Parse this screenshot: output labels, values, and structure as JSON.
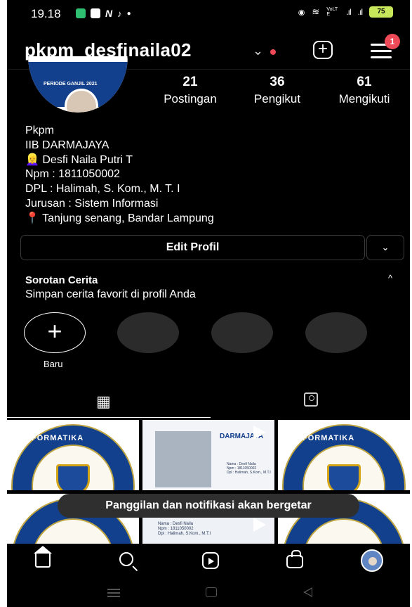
{
  "status_bar": {
    "time": "19.18",
    "signal_text": "VoLTE",
    "battery": "75"
  },
  "header": {
    "username": "pkpm_desfinaila02",
    "chevron": "⌄",
    "plus_glyph": "+",
    "notification_count": "1"
  },
  "profile": {
    "avatar_caption": "PERIODE GANJIL 2021",
    "stats": [
      {
        "value": "21",
        "label": "Postingan"
      },
      {
        "value": "36",
        "label": "Pengikut"
      },
      {
        "value": "61",
        "label": "Mengikuti"
      }
    ],
    "bio": [
      "Pkpm",
      "IIB DARMAJAYA",
      "👱‍♀️ Desfi Naila Putri T",
      "Npm : 1811050002",
      "DPL : Halimah, S. Kom., M. T. I",
      "Jurusan : Sistem Informasi",
      "📍 Tanjung senang, Bandar Lampung"
    ],
    "edit_button": "Edit Profil",
    "dropdown_glyph": "⌄"
  },
  "highlights": {
    "title": "Sorotan Cerita",
    "caret": "^",
    "subtitle": "Simpan cerita favorit di profil Anda",
    "new_glyph": "+",
    "new_label": "Baru"
  },
  "tabs": {
    "grid_glyph": "▦"
  },
  "posts": {
    "emblem_text": "INFORMATIKA",
    "darmajaya_label": "DARMAJAYA",
    "caption_lines": [
      "Nama : Desfi Naila",
      "Npm : 1811050002",
      "Dpl : Halimah, S.Kom., M.T.I"
    ]
  },
  "toast": {
    "message": "Panggilan dan notifikasi akan bergetar"
  },
  "colors": {
    "background": "#000000",
    "badge_red": "#ed4956",
    "toast_bg": "#2f2f2f",
    "emblem_blue": "#13408c",
    "emblem_gold": "#d4a517"
  },
  "icons": {
    "bottom_nav": [
      "home-icon",
      "search-icon",
      "reels-icon",
      "shop-icon",
      "profile-avatar"
    ],
    "android_nav": [
      "recent-apps-icon",
      "home-button-icon",
      "back-icon"
    ]
  }
}
